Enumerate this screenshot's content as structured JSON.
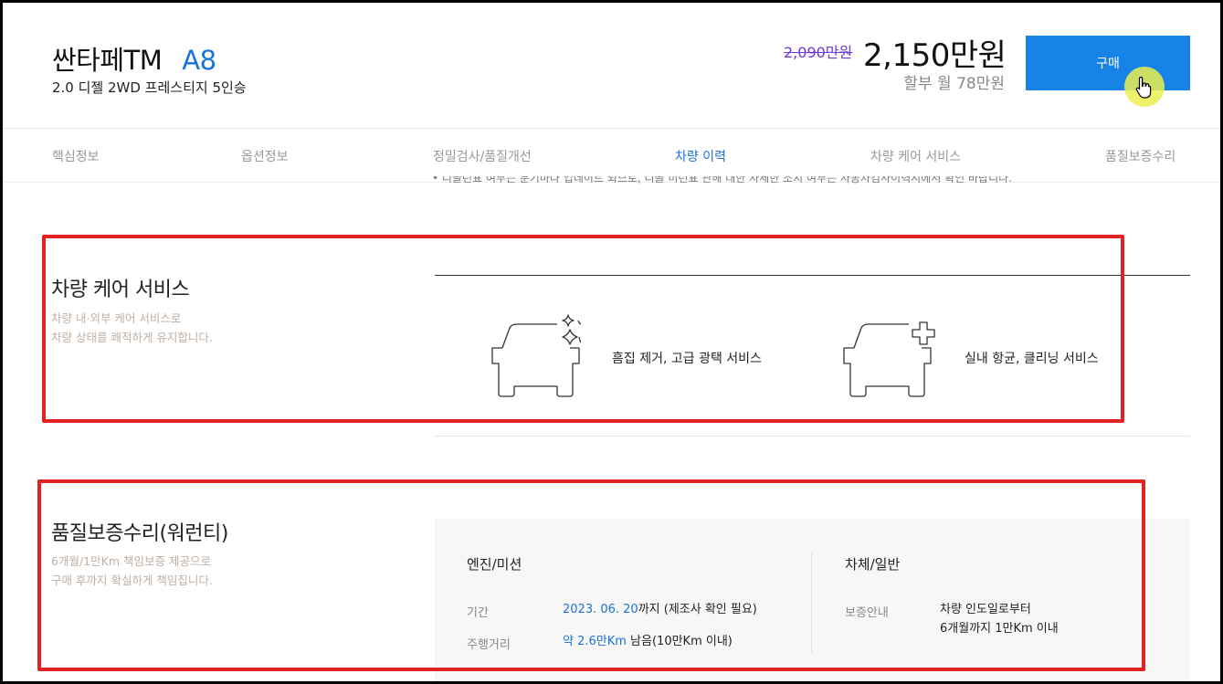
{
  "header": {
    "model": "싼타페TM",
    "grade": "A8",
    "trim": "2.0 디젤 2WD 프레스티지 5인승",
    "original_price": "2,090만원",
    "price": "2,150만원",
    "monthly": "할부 월 78만원",
    "buy_label": "구매"
  },
  "tabs": [
    {
      "label": "핵심정보",
      "active": false
    },
    {
      "label": "옵션정보",
      "active": false
    },
    {
      "label": "정밀검사/품질개선",
      "active": false
    },
    {
      "label": "차량 이력",
      "active": true
    },
    {
      "label": "차량 케어 서비스",
      "active": false
    },
    {
      "label": "품질보증수리",
      "active": false
    }
  ],
  "clipped_note": "• 디골런표 여부는 분기마다 업데이트 되므로, 디골 미런표 관해 대한 자세한 조치 여부는 자동차검사이력시에서 확인 바랍니다.",
  "care": {
    "title": "차량 케어 서비스",
    "desc_line1": "차량 내·외부 케어 서비스로",
    "desc_line2": "차량 상태를 쾌적하게 유지합니다.",
    "items": [
      {
        "label": "흠집 제거, 고급 광택 서비스",
        "icon": "car-sparkle-icon"
      },
      {
        "label": "실내 항균, 클리닝 서비스",
        "icon": "car-cross-icon"
      }
    ]
  },
  "warranty": {
    "title": "품질보증수리(워런티)",
    "desc_line1": "6개월/1만Km 책임보증 제공으로",
    "desc_line2": "구매 후까지 확실하게 책임집니다.",
    "engine": {
      "title": "엔진/미션",
      "period_key": "기간",
      "period_date": "2023. 06. 20",
      "period_rest": "까지 (제조사 확인 필요)",
      "distance_key": "주행거리",
      "distance_value": "약 2.6만Km",
      "distance_rest": " 남음(10만Km 이내)"
    },
    "body": {
      "title": "차체/일반",
      "guide_key": "보증안내",
      "guide_line1": "차량 인도일로부터",
      "guide_line2": "6개월까지 1만Km 이내"
    }
  },
  "colors": {
    "accent": "#1783e8",
    "highlight": "#e02424",
    "strike": "#6b3bd6"
  }
}
